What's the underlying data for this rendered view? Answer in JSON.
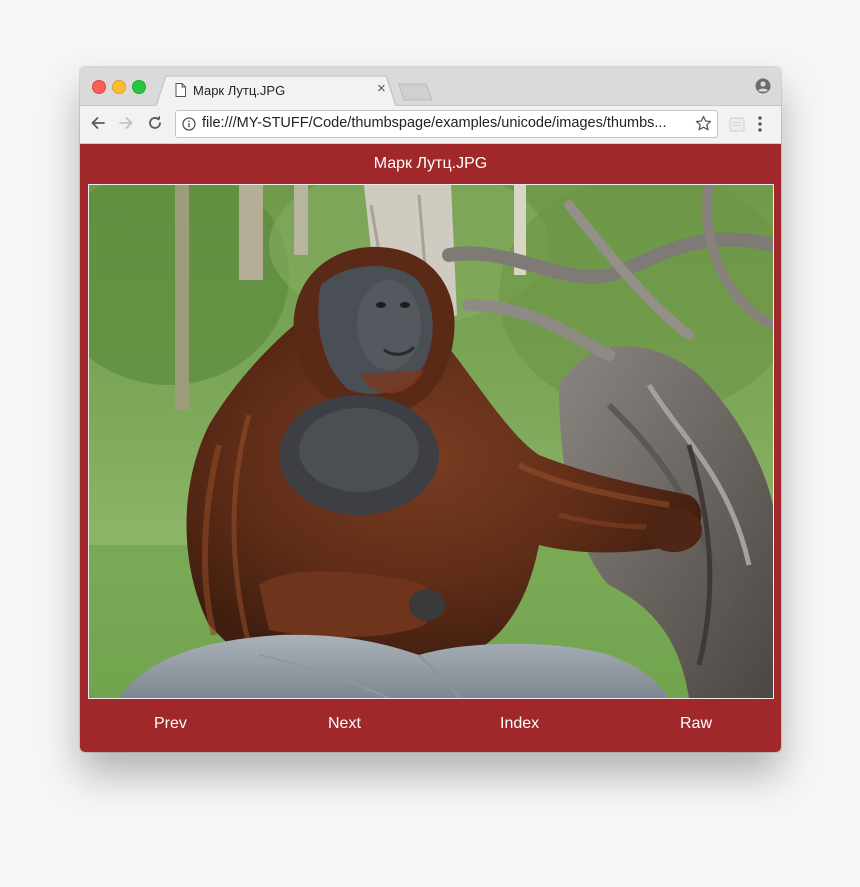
{
  "tab": {
    "title": "Марк Лутц.JPG",
    "close_glyph": "×"
  },
  "toolbar": {
    "url": "file:///MY-STUFF/Code/thumbspage/examples/unicode/images/thumbs..."
  },
  "page": {
    "title": "Марк Лутц.JPG",
    "background_color": "#a0282b",
    "image_subject": "orangutan sitting behind a rock next to a driftwood stump",
    "nav": {
      "prev": "Prev",
      "next": "Next",
      "index": "Index",
      "raw": "Raw"
    }
  },
  "icons": {
    "tab": "document-icon",
    "back": "arrow-left-icon",
    "forward": "arrow-right-icon",
    "reload": "reload-icon",
    "info": "info-icon",
    "bookmark": "star-icon",
    "extension": "extension-icon",
    "menu": "kebab-menu-icon",
    "profile": "profile-icon"
  }
}
